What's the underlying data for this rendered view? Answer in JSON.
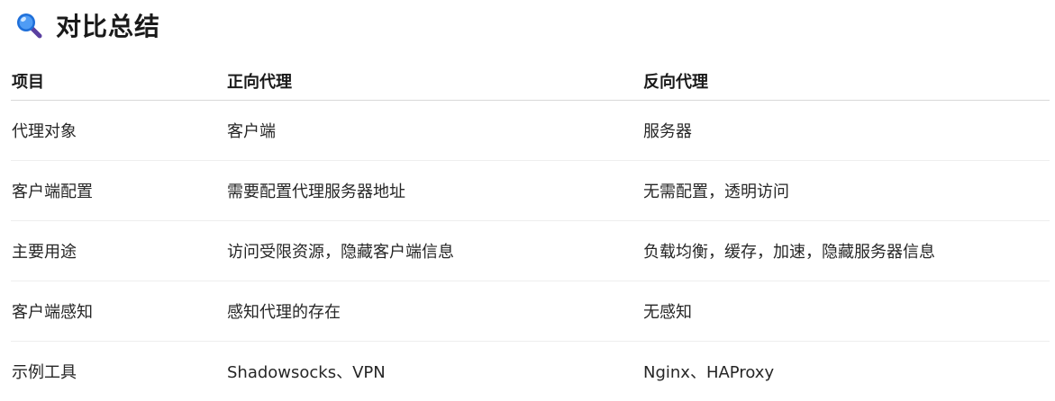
{
  "heading": {
    "icon": "magnifier-icon",
    "title": "对比总结"
  },
  "table": {
    "headers": [
      "项目",
      "正向代理",
      "反向代理"
    ],
    "rows": [
      [
        "代理对象",
        "客户端",
        "服务器"
      ],
      [
        "客户端配置",
        "需要配置代理服务器地址",
        "无需配置，透明访问"
      ],
      [
        "主要用途",
        "访问受限资源，隐藏客户端信息",
        "负载均衡，缓存，加速，隐藏服务器信息"
      ],
      [
        "客户端感知",
        "感知代理的存在",
        "无感知"
      ],
      [
        "示例工具",
        "Shadowsocks、VPN",
        "Nginx、HAProxy"
      ]
    ]
  },
  "colors": {
    "magnifier_lens": "#1e6fd9",
    "magnifier_handle": "#5a3fa0",
    "header_divider": "#d9d9d9",
    "row_divider": "#eeeeee"
  }
}
